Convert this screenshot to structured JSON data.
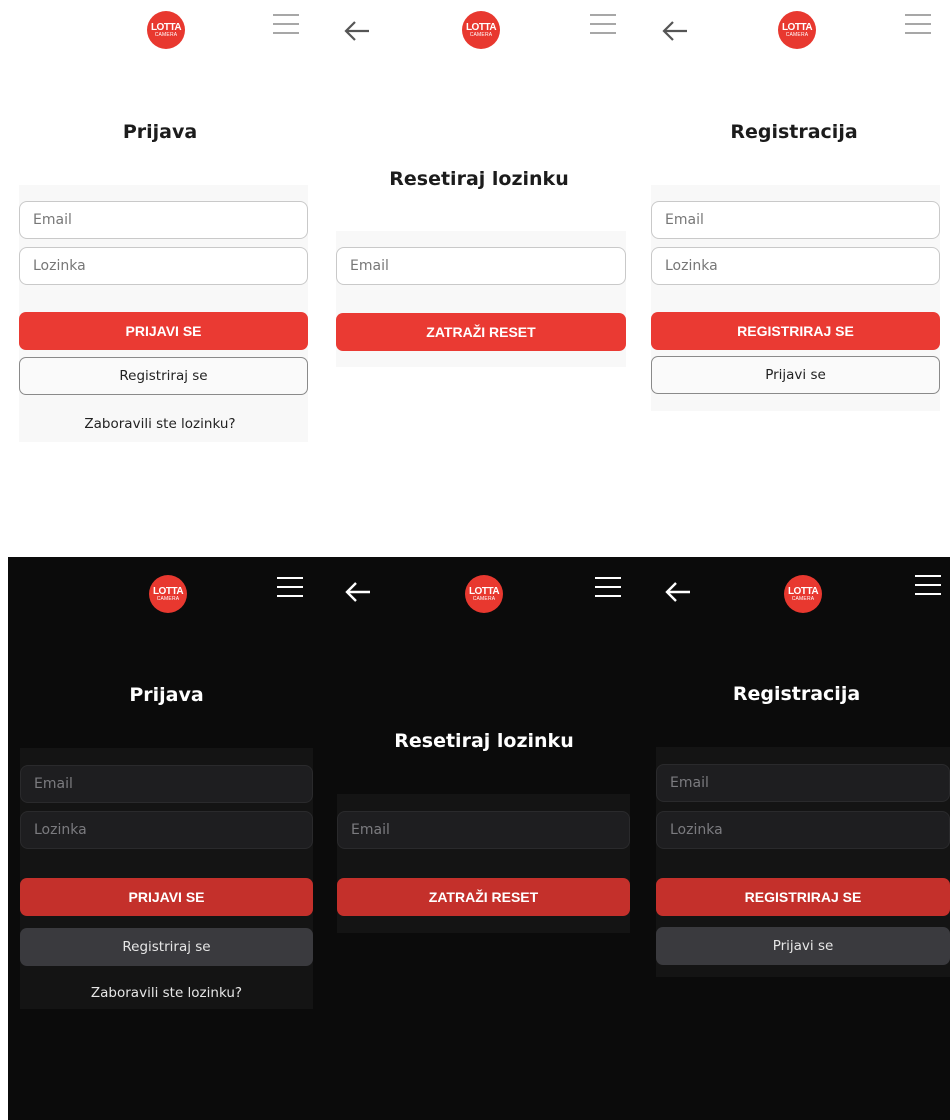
{
  "logo": {
    "line1": "LOTTA",
    "line2": "CAMERA"
  },
  "colors": {
    "accent": "#ea3a33",
    "accent_dark_mode": "#c4302b",
    "dark_bg": "#0b0b0b"
  },
  "icons": {
    "menu": "hamburger-menu-icon",
    "back": "arrow-left-icon"
  },
  "login": {
    "title": "Prijava",
    "email_placeholder": "Email",
    "password_placeholder": "Lozinka",
    "submit_label": "PRIJAVI SE",
    "register_label": "Registriraj se",
    "forgot_label": "Zaboravili ste lozinku?"
  },
  "reset": {
    "title": "Resetiraj lozinku",
    "email_placeholder": "Email",
    "submit_label": "ZATRAŽI RESET"
  },
  "register": {
    "title": "Registracija",
    "email_placeholder": "Email",
    "password_placeholder": "Lozinka",
    "submit_label": "REGISTRIRAJ SE",
    "login_label": "Prijavi se"
  }
}
